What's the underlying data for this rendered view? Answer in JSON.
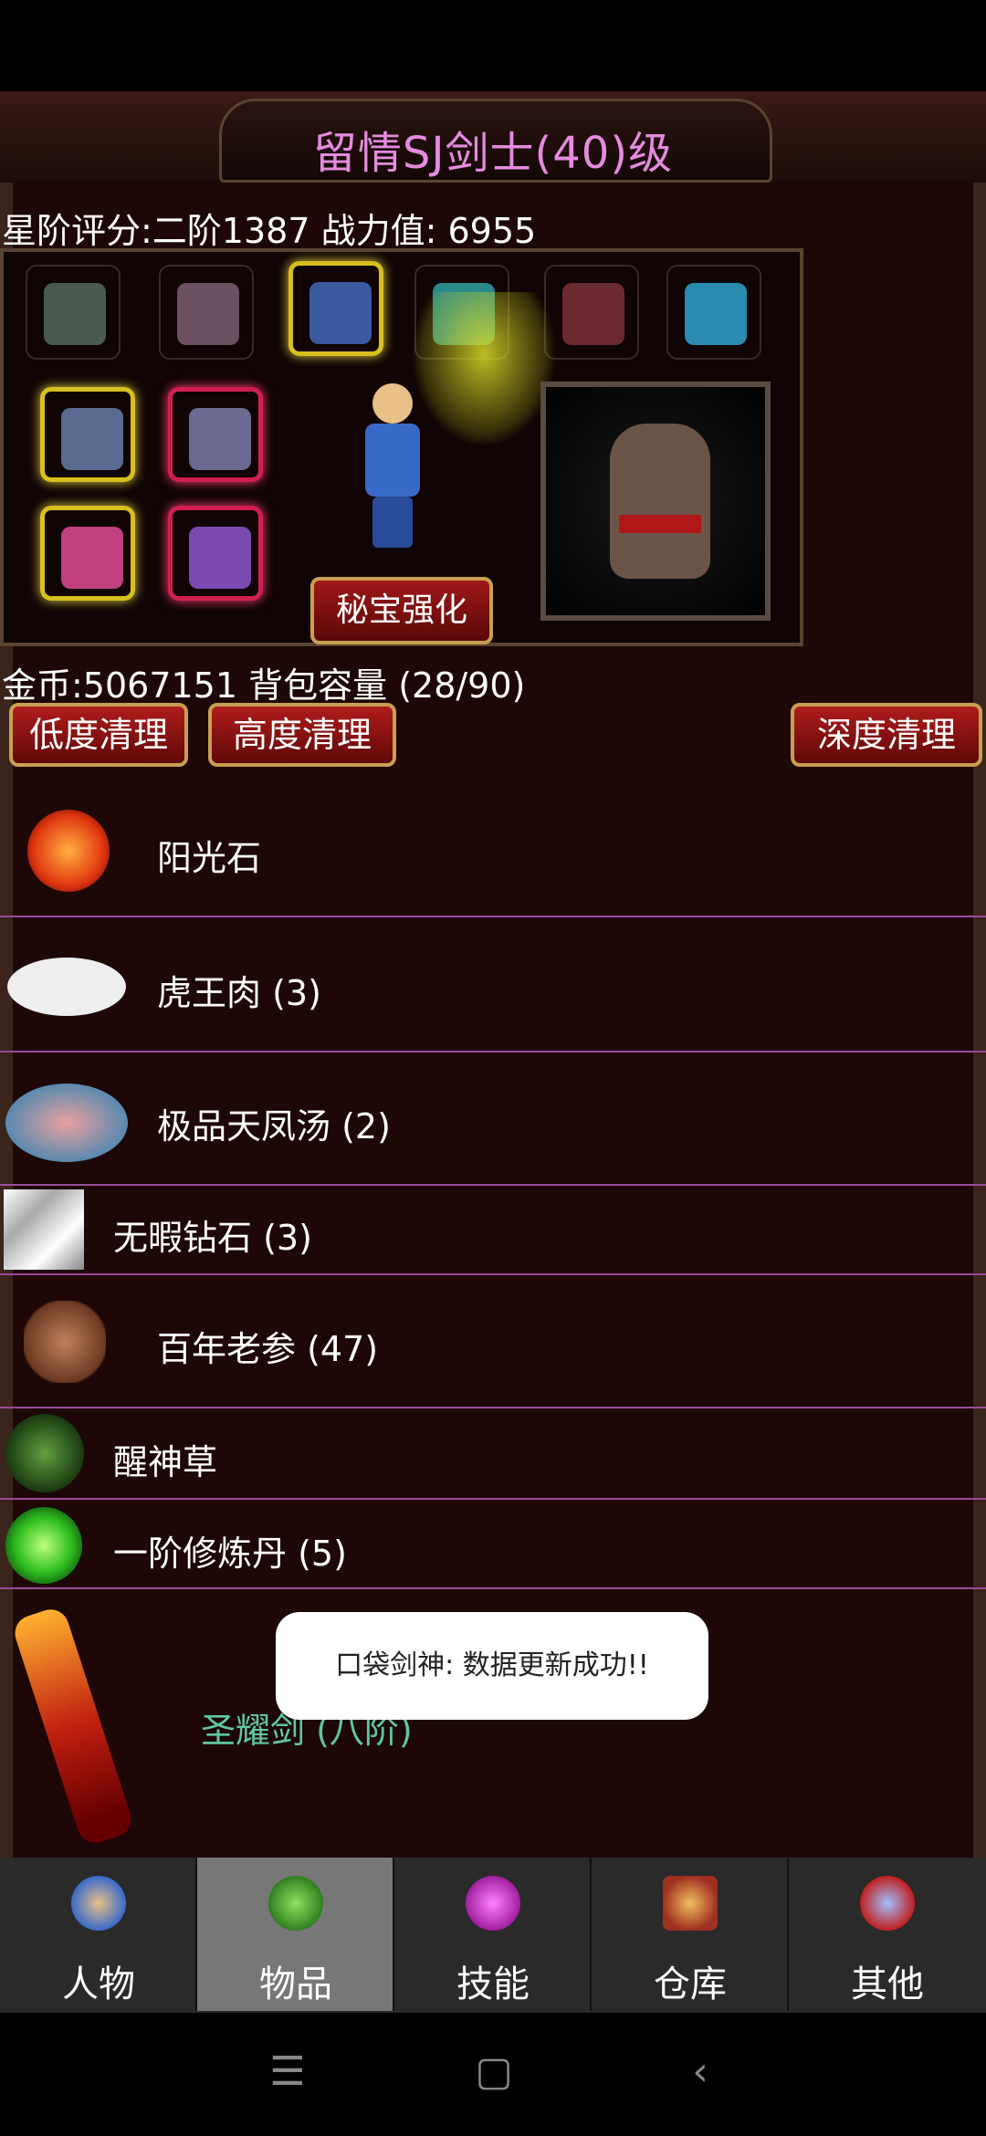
{
  "title": "留情SJ剑士(40)级",
  "score_line": "星阶评分:二阶1387 战力值: 6955",
  "secret_button": "秘宝强化",
  "coin_line": "金币:5067151 背包容量 (28/90)",
  "clean_buttons": [
    "低度清理",
    "高度清理",
    "深度清理"
  ],
  "items": [
    {
      "name": "阳光石"
    },
    {
      "name": "虎王肉 (3)"
    },
    {
      "name": "极品天凤汤 (2)"
    },
    {
      "name": "无暇钻石 (3)"
    },
    {
      "name": "百年老参 (47)"
    },
    {
      "name": "醒神草"
    },
    {
      "name": "一阶修炼丹 (5)"
    },
    {
      "name": "圣耀剑 (八阶)"
    }
  ],
  "toast": "口袋剑神: 数据更新成功!!",
  "nav": [
    {
      "label": "人物",
      "icon": "character-icon"
    },
    {
      "label": "物品",
      "icon": "potion-icon"
    },
    {
      "label": "技能",
      "icon": "skill-orb-icon"
    },
    {
      "label": "仓库",
      "icon": "warehouse-icon"
    },
    {
      "label": "其他",
      "icon": "other-icon"
    }
  ],
  "active_tab": "物品",
  "colors": {
    "title": "#e58be0",
    "item_special": "#5fc8a0",
    "divider": "#9a4a9a",
    "button_red": "#b01c1c",
    "button_border": "#c8a050"
  }
}
